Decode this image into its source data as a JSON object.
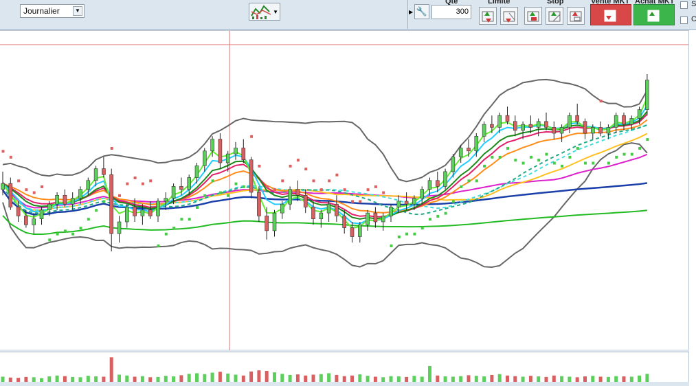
{
  "toolbar": {
    "period": "Journalier",
    "qty_label": "Qte",
    "qty_value": "300",
    "limit_label": "Limite",
    "stop_label": "Stop",
    "sell_label": "Vente MKT",
    "buy_label": "Achat MKT",
    "check1_label": "S",
    "check2_label": "C"
  },
  "colors": {
    "up": "#5ccf5c",
    "down": "#d96060",
    "bollinger": "#666666",
    "sar_up": "#44cc44",
    "sar_down": "#e06060",
    "crosshair": "#e07070"
  },
  "chart_data": {
    "type": "candlestick",
    "candles": [
      [
        0.51,
        0.57,
        0.49,
        0.53
      ],
      [
        0.53,
        0.55,
        0.44,
        0.45
      ],
      [
        0.45,
        0.47,
        0.4,
        0.42
      ],
      [
        0.42,
        0.44,
        0.38,
        0.39
      ],
      [
        0.39,
        0.43,
        0.36,
        0.41
      ],
      [
        0.41,
        0.45,
        0.39,
        0.44
      ],
      [
        0.44,
        0.47,
        0.42,
        0.46
      ],
      [
        0.46,
        0.5,
        0.44,
        0.49
      ],
      [
        0.49,
        0.51,
        0.45,
        0.46
      ],
      [
        0.46,
        0.5,
        0.44,
        0.48
      ],
      [
        0.48,
        0.52,
        0.46,
        0.51
      ],
      [
        0.51,
        0.55,
        0.49,
        0.54
      ],
      [
        0.54,
        0.59,
        0.52,
        0.58
      ],
      [
        0.58,
        0.62,
        0.55,
        0.56
      ],
      [
        0.56,
        0.58,
        0.3,
        0.36
      ],
      [
        0.36,
        0.42,
        0.33,
        0.4
      ],
      [
        0.4,
        0.46,
        0.38,
        0.45
      ],
      [
        0.45,
        0.48,
        0.4,
        0.42
      ],
      [
        0.42,
        0.46,
        0.39,
        0.44
      ],
      [
        0.44,
        0.47,
        0.41,
        0.42
      ],
      [
        0.42,
        0.48,
        0.4,
        0.47
      ],
      [
        0.47,
        0.5,
        0.44,
        0.48
      ],
      [
        0.48,
        0.53,
        0.46,
        0.52
      ],
      [
        0.52,
        0.55,
        0.49,
        0.51
      ],
      [
        0.51,
        0.56,
        0.49,
        0.55
      ],
      [
        0.55,
        0.6,
        0.53,
        0.59
      ],
      [
        0.59,
        0.65,
        0.57,
        0.64
      ],
      [
        0.64,
        0.69,
        0.62,
        0.68
      ],
      [
        0.68,
        0.7,
        0.58,
        0.6
      ],
      [
        0.6,
        0.64,
        0.57,
        0.63
      ],
      [
        0.63,
        0.67,
        0.61,
        0.65
      ],
      [
        0.65,
        0.68,
        0.6,
        0.61
      ],
      [
        0.61,
        0.62,
        0.48,
        0.5
      ],
      [
        0.5,
        0.52,
        0.4,
        0.42
      ],
      [
        0.42,
        0.45,
        0.34,
        0.37
      ],
      [
        0.37,
        0.44,
        0.35,
        0.43
      ],
      [
        0.43,
        0.47,
        0.41,
        0.46
      ],
      [
        0.46,
        0.52,
        0.44,
        0.51
      ],
      [
        0.51,
        0.54,
        0.47,
        0.49
      ],
      [
        0.49,
        0.51,
        0.43,
        0.45
      ],
      [
        0.45,
        0.47,
        0.39,
        0.41
      ],
      [
        0.41,
        0.44,
        0.38,
        0.43
      ],
      [
        0.43,
        0.47,
        0.4,
        0.46
      ],
      [
        0.46,
        0.49,
        0.4,
        0.42
      ],
      [
        0.42,
        0.44,
        0.36,
        0.38
      ],
      [
        0.38,
        0.4,
        0.33,
        0.35
      ],
      [
        0.35,
        0.4,
        0.33,
        0.39
      ],
      [
        0.39,
        0.44,
        0.37,
        0.43
      ],
      [
        0.43,
        0.45,
        0.38,
        0.4
      ],
      [
        0.4,
        0.43,
        0.37,
        0.42
      ],
      [
        0.42,
        0.46,
        0.4,
        0.45
      ],
      [
        0.45,
        0.49,
        0.43,
        0.47
      ],
      [
        0.47,
        0.5,
        0.44,
        0.46
      ],
      [
        0.46,
        0.49,
        0.44,
        0.48
      ],
      [
        0.48,
        0.52,
        0.46,
        0.51
      ],
      [
        0.51,
        0.55,
        0.49,
        0.54
      ],
      [
        0.54,
        0.57,
        0.5,
        0.52
      ],
      [
        0.52,
        0.58,
        0.51,
        0.57
      ],
      [
        0.57,
        0.63,
        0.55,
        0.62
      ],
      [
        0.62,
        0.66,
        0.6,
        0.65
      ],
      [
        0.65,
        0.68,
        0.62,
        0.64
      ],
      [
        0.64,
        0.7,
        0.62,
        0.69
      ],
      [
        0.69,
        0.74,
        0.67,
        0.73
      ],
      [
        0.73,
        0.76,
        0.7,
        0.72
      ],
      [
        0.72,
        0.77,
        0.7,
        0.76
      ],
      [
        0.76,
        0.79,
        0.73,
        0.74
      ],
      [
        0.74,
        0.76,
        0.69,
        0.71
      ],
      [
        0.71,
        0.74,
        0.68,
        0.73
      ],
      [
        0.73,
        0.76,
        0.7,
        0.72
      ],
      [
        0.72,
        0.75,
        0.69,
        0.74
      ],
      [
        0.74,
        0.77,
        0.71,
        0.72
      ],
      [
        0.72,
        0.74,
        0.68,
        0.7
      ],
      [
        0.7,
        0.73,
        0.67,
        0.72
      ],
      [
        0.72,
        0.77,
        0.7,
        0.76
      ],
      [
        0.76,
        0.8,
        0.73,
        0.74
      ],
      [
        0.74,
        0.75,
        0.68,
        0.7
      ],
      [
        0.7,
        0.73,
        0.68,
        0.72
      ],
      [
        0.72,
        0.74,
        0.69,
        0.7
      ],
      [
        0.7,
        0.73,
        0.68,
        0.72
      ],
      [
        0.72,
        0.77,
        0.7,
        0.76
      ],
      [
        0.76,
        0.77,
        0.71,
        0.73
      ],
      [
        0.73,
        0.76,
        0.71,
        0.75
      ],
      [
        0.75,
        0.79,
        0.73,
        0.78
      ],
      [
        0.78,
        0.9,
        0.76,
        0.88
      ]
    ],
    "volumes": [
      0.18,
      0.15,
      0.14,
      0.17,
      0.16,
      0.13,
      0.19,
      0.22,
      0.2,
      0.17,
      0.16,
      0.21,
      0.19,
      0.18,
      0.85,
      0.25,
      0.22,
      0.18,
      0.2,
      0.16,
      0.17,
      0.21,
      0.19,
      0.23,
      0.28,
      0.3,
      0.27,
      0.32,
      0.35,
      0.29,
      0.25,
      0.22,
      0.36,
      0.4,
      0.38,
      0.33,
      0.28,
      0.24,
      0.26,
      0.22,
      0.25,
      0.27,
      0.3,
      0.24,
      0.2,
      0.22,
      0.26,
      0.21,
      0.18,
      0.16,
      0.2,
      0.19,
      0.17,
      0.21,
      0.18,
      0.55,
      0.22,
      0.19,
      0.18,
      0.2,
      0.23,
      0.21,
      0.19,
      0.24,
      0.27,
      0.22,
      0.2,
      0.18,
      0.21,
      0.19,
      0.17,
      0.22,
      0.2,
      0.18,
      0.16,
      0.19,
      0.21,
      0.18,
      0.17,
      0.2,
      0.19,
      0.18,
      0.22,
      0.28
    ]
  }
}
